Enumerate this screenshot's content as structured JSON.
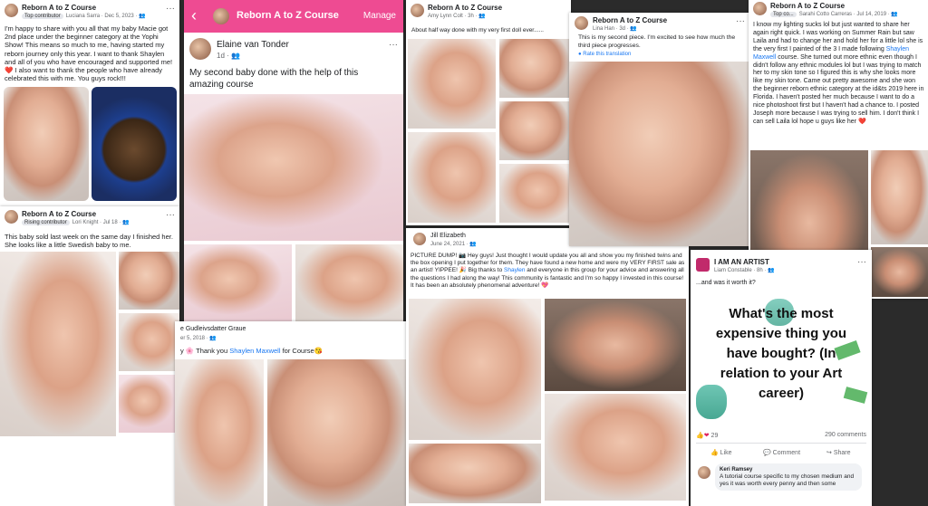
{
  "card1": {
    "group": "Reborn A to Z Course",
    "badge": "Top contributor",
    "author_meta": "Luciana Sarra · Dec 5, 2023 · 👥",
    "body": "I'm happy to share with you all that my baby Macie got 2nd place under the beginner category at the Yophi Show! This means so much to me, having started my reborn journey only this year. I want to thank Shaylen and all of you who have encouraged and supported me! ❤️ I also want to thank the people who have already celebrated this with me. You guys rock!!!"
  },
  "card2": {
    "group": "Reborn A to Z Course",
    "badge": "Rising contributor",
    "author_meta": "Lori Knight · Jul 18 · 👥",
    "body": "This baby sold last week on the same day I finished her. She looks like a little Swedish baby to me."
  },
  "card3": {
    "header_title": "Reborn A to Z Course",
    "manage": "Manage",
    "back": "‹",
    "author": "Elaine van Tonder",
    "time": "1d · 👥",
    "body": "My second baby done with the help of this amazing course"
  },
  "card4": {
    "author": "e Gudleivsdatter Graue",
    "time": "er 5, 2018 · 👥",
    "body_pre": "y 🌸 Thank you ",
    "mention": "Shaylen Maxwell",
    "body_post": " for Course😘"
  },
  "card5": {
    "group": "Reborn A to Z Course",
    "author_meta": "Amy Lynn Colt · 3h · 👥",
    "body": "About half way done with my very first doll ever......"
  },
  "card6": {
    "author": "Jill Elizabeth",
    "time": "June 24, 2021 · 👥",
    "body_a": "PICTURE DUMP! 📷 Hey guys! Just thought I would update you all and show you my finished twins and the box opening I put together for them. They have found a new home and were my VERY FIRST sale as an artist! YIPPEE! 🎉 Big thanks to ",
    "mention": "Shaylen",
    "body_b": " and everyone in this group for your advice and answering all the questions I had along the way! This community is fantastic and I'm so happy I invested in this course! It has been an absolutely phenomenal adventure! 💖"
  },
  "card7": {
    "group": "Reborn A to Z Course",
    "author_meta": "Lina Han · 3d · 👥",
    "body": "This is my second piece. I'm excited to see how much the third piece progresses.",
    "translate": "Rate this translation"
  },
  "card8": {
    "group": "Reborn A to Z Course",
    "badge": "Top co...",
    "author_meta": "Sarahi Cotto Carreras · Jul 14, 2019 · 👥",
    "body_a": "I know my lighting sucks lol but just wanted to share her again right quick. I was working on Summer Rain but saw Laila and had to change her and hold her for a little lol she is the very first I painted of the 3 I made following ",
    "mention": "Shaylen Maxwell",
    "body_b": " course. She turned out more ethnic even though I didn't follow any ethnic modules lol but I was trying to match her to my skin tone so I figured this is why she looks more like my skin tone. Came out pretty awesome and she won the beginner reborn ethnic category at the id&ts 2019 here in Florida. I haven't posted her much because I want to do a nice photoshoot first but I haven't had a chance to. I posted Joseph more because I was trying to sell him. I don't think I can sell Laila lol hope u guys like her ❤️"
  },
  "card9": {
    "group": "I AM AN ARTIST",
    "author_meta": "Liam Constable · 8h · 👥",
    "body": "...and was it worth it?",
    "image_text": "What's the most expensive thing you have bought? (In relation to your Art career)",
    "reactions": "29",
    "comments_count": "290 comments",
    "like": "Like",
    "comment": "Comment",
    "share": "Share",
    "commenter": "Keri Ramsey",
    "comment_text": "A tutorial course specific to my chosen medium and yes it was worth every penny and then some"
  },
  "colors": {
    "brand_pink": "#ee4b92",
    "link": "#1877f2",
    "money_green": "#4fb79c"
  }
}
